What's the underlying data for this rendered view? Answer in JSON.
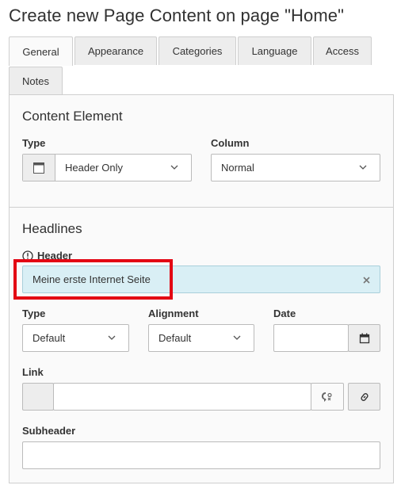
{
  "page_title": "Create new Page Content on page \"Home\"",
  "tabs": [
    {
      "label": "General",
      "active": true
    },
    {
      "label": "Appearance",
      "active": false
    },
    {
      "label": "Categories",
      "active": false
    },
    {
      "label": "Language",
      "active": false
    },
    {
      "label": "Access",
      "active": false
    },
    {
      "label": "Notes",
      "active": false
    }
  ],
  "content_element": {
    "legend": "Content Element",
    "type_label": "Type",
    "type_value": "Header Only",
    "type_icon": "header-only-icon",
    "column_label": "Column",
    "column_value": "Normal"
  },
  "headlines": {
    "legend": "Headlines",
    "header_label": "Header",
    "header_value": "Meine erste Internet Seite",
    "header_icon": "info-circle-icon",
    "clear_icon": "clear-icon",
    "type_label": "Type",
    "type_value": "Default",
    "alignment_label": "Alignment",
    "alignment_value": "Default",
    "date_label": "Date",
    "date_value": "",
    "date_icon": "calendar-icon",
    "link_label": "Link",
    "link_value": "",
    "link_icons": [
      "link-explanation-icon",
      "link-icon"
    ],
    "subheader_label": "Subheader",
    "subheader_value": ""
  },
  "colors": {
    "header_field_bg": "#d9eff5",
    "highlight": "#e30613"
  }
}
